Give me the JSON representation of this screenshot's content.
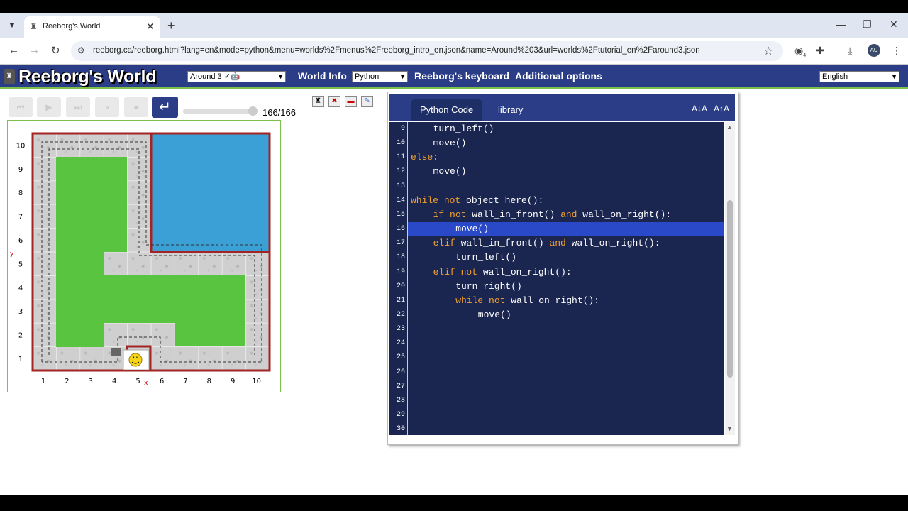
{
  "browser": {
    "tab_title": "Reeborg's World",
    "new_tab": "+",
    "url": "reeborg.ca/reeborg.html?lang=en&mode=python&menu=worlds%2Fmenus%2Freeborg_intro_en.json&name=Around%203&url=worlds%2Ftutorial_en%2Faround3.json",
    "avatar": "AU",
    "ext_badge": "4"
  },
  "app": {
    "logo": "Reeborg's World",
    "world_select": "Around 3 ✓🤖",
    "world_info": "World Info",
    "mode_select": "Python",
    "keyboard": "Reeborg's keyboard",
    "additional": "Additional options",
    "language_select": "English"
  },
  "controls": {
    "step_counter": "166/166",
    "reverse_glyph": "↵"
  },
  "world": {
    "x_ticks": [
      "1",
      "2",
      "3",
      "4",
      "5",
      "6",
      "7",
      "8",
      "9",
      "10"
    ],
    "y_ticks": [
      "1",
      "2",
      "3",
      "4",
      "5",
      "6",
      "7",
      "8",
      "9",
      "10"
    ],
    "x_label": "x",
    "y_label": "y",
    "colors": {
      "grass": "#58c43f",
      "water": "#3aa0d6",
      "wall": "#a32424",
      "tile": "#cfcfcf"
    }
  },
  "editor": {
    "tabs": [
      "Python Code",
      "library"
    ],
    "font_smaller": "A↓A",
    "font_larger": "A↑A",
    "line_numbers": [
      "9",
      "10",
      "11",
      "12",
      "13",
      "14",
      "15",
      "16",
      "17",
      "18",
      "19",
      "20",
      "21",
      "22",
      "23",
      "24",
      "25",
      "26",
      "27",
      "28",
      "29",
      "30"
    ],
    "lines": [
      {
        "indent": 4,
        "text": "turn_left()"
      },
      {
        "indent": 4,
        "text": "move()"
      },
      {
        "indent": 0,
        "text": "else:"
      },
      {
        "indent": 4,
        "text": "move()"
      },
      {
        "indent": 0,
        "text": ""
      },
      {
        "indent": 0,
        "text": "while not object_here():"
      },
      {
        "indent": 4,
        "text": "if not wall_in_front() and wall_on_right():"
      },
      {
        "indent": 8,
        "text": "move()"
      },
      {
        "indent": 4,
        "text": "elif wall_in_front() and wall_on_right():"
      },
      {
        "indent": 8,
        "text": "turn_left()"
      },
      {
        "indent": 4,
        "text": "elif not wall_on_right():"
      },
      {
        "indent": 8,
        "text": "turn_right()"
      },
      {
        "indent": 8,
        "text": "while not wall_on_right():"
      },
      {
        "indent": 12,
        "text": "move()"
      }
    ]
  }
}
